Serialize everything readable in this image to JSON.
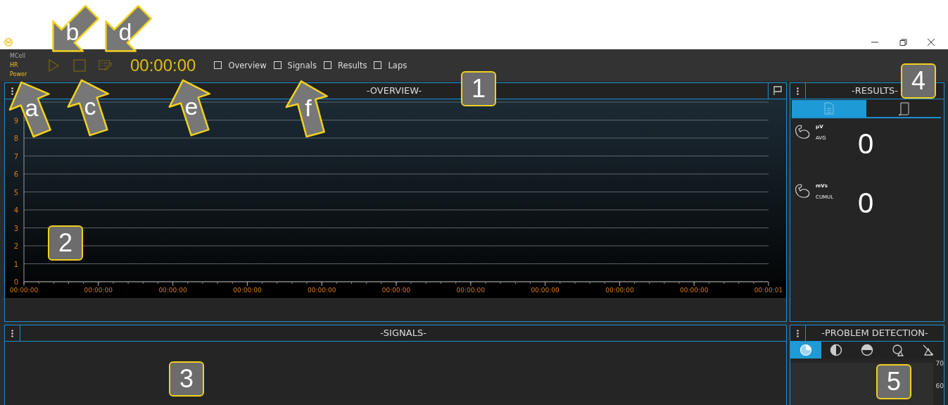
{
  "toolbar": {
    "sources": [
      {
        "label": "MCell",
        "active": false
      },
      {
        "label": "HR",
        "active": true
      },
      {
        "label": "Power",
        "active": true
      }
    ],
    "timer": "00:00:00",
    "views": [
      {
        "label": "Overview",
        "checked": false
      },
      {
        "label": "Signals",
        "checked": false
      },
      {
        "label": "Results",
        "checked": false
      },
      {
        "label": "Laps",
        "checked": false
      }
    ]
  },
  "overview": {
    "title": "-OVERVIEW-",
    "chart_data": {
      "type": "line",
      "grid": true,
      "ylim": [
        0,
        10
      ],
      "yticks": [
        0,
        1,
        2,
        3,
        4,
        5,
        6,
        7,
        8,
        9
      ],
      "categories": [
        "00:00:00",
        "00:00:00",
        "00:00:00",
        "00:00:00",
        "00:00:00",
        "00:00:00",
        "00:00:00",
        "00:00:00",
        "00:00:00",
        "00:00:00",
        "00:00:01"
      ]
    }
  },
  "results": {
    "title": "-RESULTS-",
    "tabs": [
      {
        "kind": "document",
        "selected": true
      },
      {
        "kind": "scroll",
        "selected": false
      }
    ],
    "metrics": [
      {
        "unit": "µV",
        "label": "AVG",
        "value": "0"
      },
      {
        "unit": "mVs",
        "label": "CUMUL",
        "value": "0"
      }
    ]
  },
  "signals": {
    "title": "-SIGNALS-"
  },
  "problem_detection": {
    "title": "-PROBLEM DETECTION-",
    "tabs": [
      {
        "kind": "pie",
        "selected": true
      },
      {
        "kind": "contrast",
        "selected": false
      },
      {
        "kind": "half",
        "selected": false
      },
      {
        "kind": "search-warning",
        "selected": false
      },
      {
        "kind": "crossed",
        "selected": false
      }
    ],
    "axis_labels": [
      "70",
      "60"
    ]
  },
  "callouts": [
    {
      "kind": "arrow",
      "label": "b"
    },
    {
      "kind": "arrow",
      "label": "d"
    },
    {
      "kind": "arrow",
      "label": "a"
    },
    {
      "kind": "arrow",
      "label": "c"
    },
    {
      "kind": "arrow",
      "label": "e"
    },
    {
      "kind": "arrow",
      "label": "f"
    },
    {
      "kind": "badge",
      "label": "1"
    },
    {
      "kind": "badge",
      "label": "4"
    },
    {
      "kind": "badge",
      "label": "2"
    },
    {
      "kind": "badge",
      "label": "3"
    },
    {
      "kind": "badge",
      "label": "5"
    }
  ]
}
